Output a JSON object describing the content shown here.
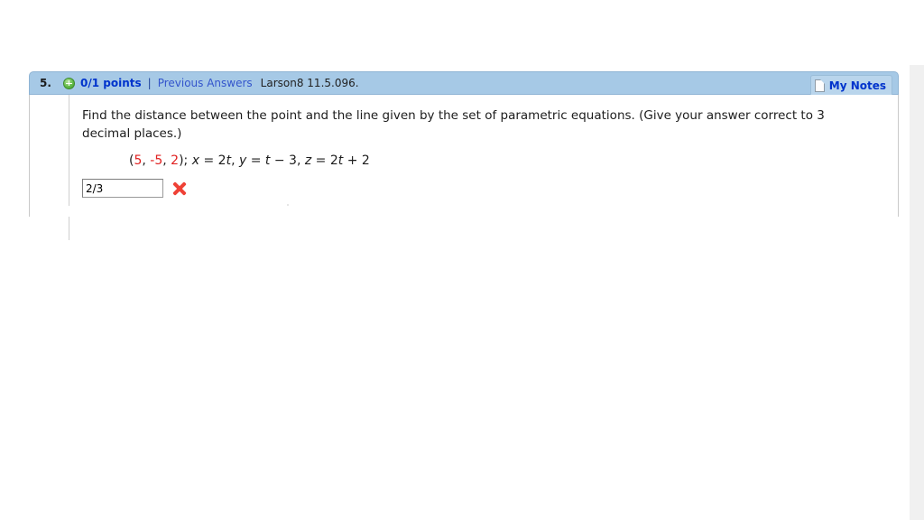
{
  "question": {
    "number": "5.",
    "points_icon": "plus-circle-icon",
    "points_label": "0/1 points",
    "separator": "|",
    "previous_answers_label": "Previous Answers",
    "textbook_reference": "Larson8 11.5.096.",
    "my_notes": {
      "icon": "note-page-icon",
      "label": "My Notes"
    },
    "prompt": "Find the distance between the point and the line given by the set of parametric equations. (Give your answer correct to 3 decimal places.)",
    "math": {
      "open_paren": "(",
      "point_x": "5",
      "comma_1": ", ",
      "point_y": "-5",
      "comma_2": ", ",
      "point_z": "2",
      "close_paren": ");",
      "equations": "x = 2t, y = t − 3, z = 2t + 2",
      "eq_x_var": "x",
      "eq_x_rhs": " = 2",
      "eq_x_param": "t",
      "eq_sep_1": ", ",
      "eq_y_var": "y",
      "eq_y_rhs_a": " = ",
      "eq_y_param": "t",
      "eq_y_rhs_b": " − 3",
      "eq_sep_2": ", ",
      "eq_z_var": "z",
      "eq_z_rhs": " = 2",
      "eq_z_param": "t",
      "eq_z_rhs_b": " + 2"
    },
    "answer": {
      "value": "2/3",
      "placeholder": "",
      "result_icon": "red-x-incorrect-icon"
    }
  },
  "colors": {
    "header_background": "#a6c9e6",
    "header_border": "#8fb4d4",
    "link_blue": "#3355cc",
    "points_blue": "#0033cc",
    "math_red": "#e02020",
    "incorrect_red": "#ef4136",
    "my_notes_background": "#b9d5ec",
    "scrollbar_track": "#f0f0f0",
    "page_background": "#ffffff"
  }
}
